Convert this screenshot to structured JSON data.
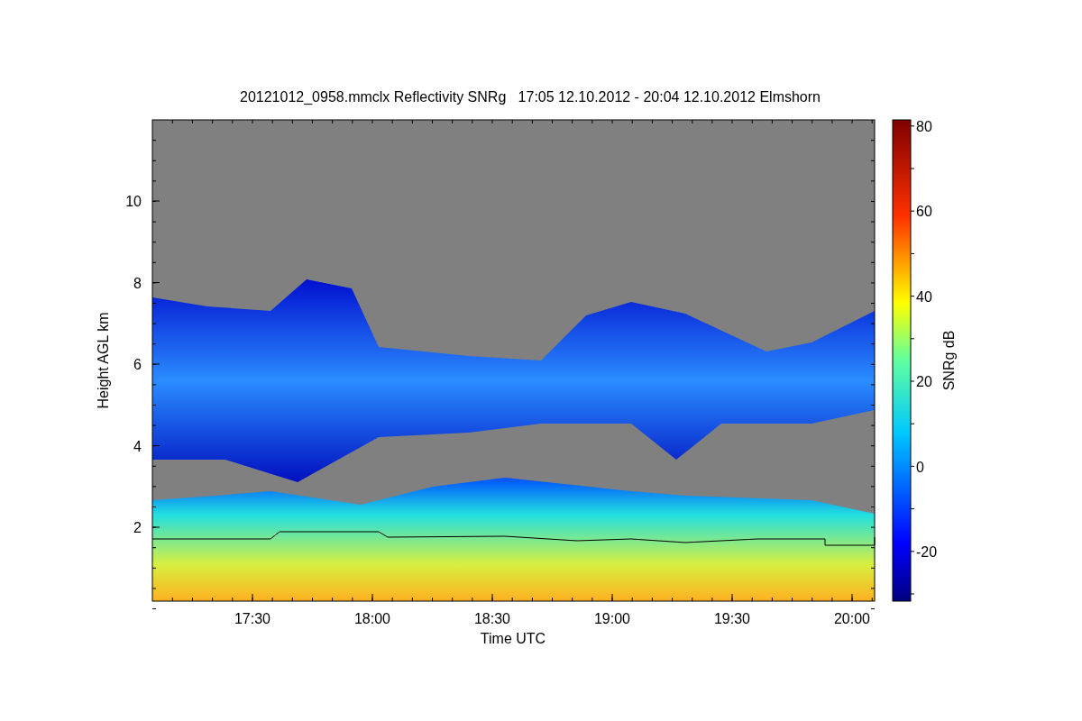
{
  "title": "20121012_0958.mmclx Reflectivity SNRg   17:05 12.10.2012 - 20:04 12.10.2012 Elmshorn",
  "plot": {
    "xlabel": "Time UTC",
    "ylabel": "Height AGL km",
    "xticks": [
      "17:30",
      "18:00",
      "18:30",
      "19:00",
      "19:30",
      "20:00"
    ],
    "yticks": [
      "10",
      "8",
      "6",
      "4",
      "2"
    ]
  },
  "colorbar": {
    "label": "SNRg dB",
    "ticks": [
      "80",
      "60",
      "40",
      "20",
      "0",
      "-20"
    ]
  }
}
